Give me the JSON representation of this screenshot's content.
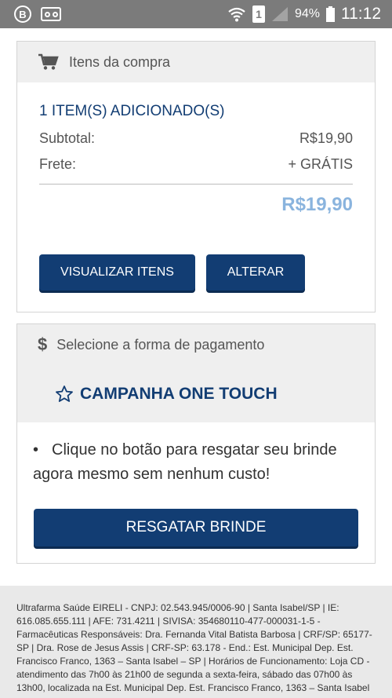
{
  "status_bar": {
    "left_icon_letter": "B",
    "battery": "94%",
    "sim": "1",
    "time": "11:12"
  },
  "purchase": {
    "header": "Itens da compra",
    "items_count": "1 ITEM(S) ADICIONADO(S)",
    "subtotal_label": "Subtotal:",
    "subtotal_value": "R$19,90",
    "shipping_label": "Frete:",
    "shipping_value": "+ GRÁTIS",
    "total": "R$19,90",
    "view_button": "VISUALIZAR ITENS",
    "alter_button": "ALTERAR"
  },
  "payment": {
    "header": "Selecione a forma de pagamento",
    "header_icon": "$",
    "campaign_title": "CAMPANHA ONE TOUCH",
    "bullet": "•",
    "description": "Clique no botão para resgatar seu brinde agora mesmo sem nenhum custo!",
    "redeem_button": "RESGATAR BRINDE"
  },
  "footer": {
    "text": "Ultrafarma Saúde EIRELI - CNPJ: 02.543.945/0006-90 | Santa Isabel/SP | IE: 616.085.655.111 | AFE: 731.4211 | SIVISA: 354680110-477-000031-1-5 - Farmacêuticas Responsáveis: Dra. Fernanda Vital Batista Barbosa | CRF/SP: 65177-SP | Dra. Rose de Jesus Assis | CRF-SP: 63.178 - End.: Est. Municipal Dep. Est. Francisco Franco, 1363 – Santa Isabel – SP | Horários de Funcionamento: Loja CD - atendimento das 7h00 às 21h00 de segunda a sexta-feira, sábado das 07h00 às 13h00, localizada na Est. Municipal Dep. Est. Francisco Franco, 1363 – Santa Isabel"
  },
  "icons": {
    "cart": "shopping-cart-icon",
    "dollar": "dollar-icon",
    "star": "star-outline-icon",
    "wifi": "wifi-icon",
    "signal": "signal-icon",
    "voicemail": "voicemail-icon"
  },
  "colors": {
    "primary": "#123d73",
    "total": "#8ab4de",
    "panel": "#efefef"
  }
}
